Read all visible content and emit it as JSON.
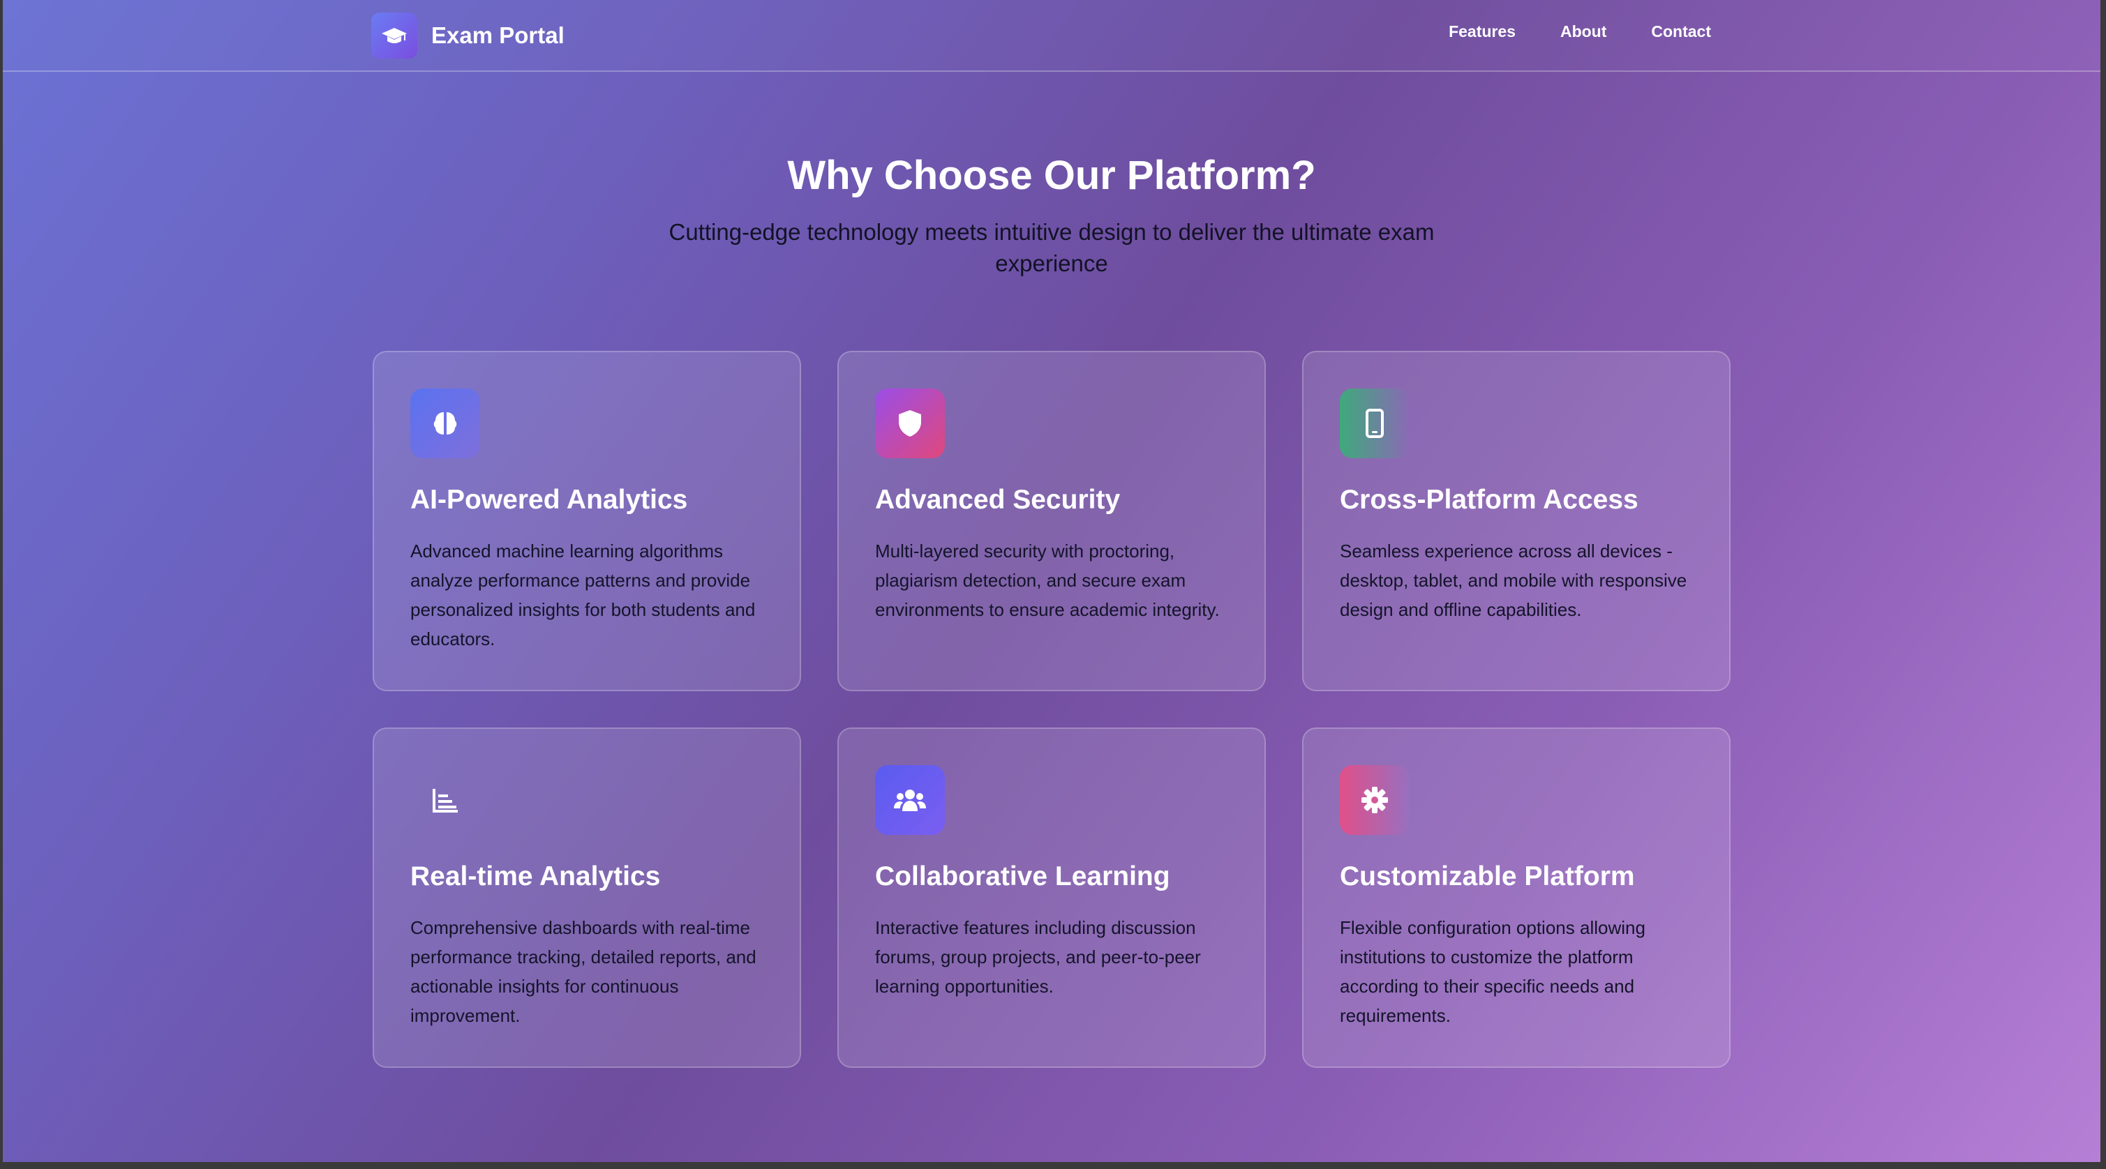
{
  "brand": {
    "name": "Exam Portal",
    "icon": "graduation-cap-icon"
  },
  "nav": {
    "links": [
      "Features",
      "About",
      "Contact"
    ]
  },
  "hero": {
    "title": "Why Choose Our Platform?",
    "subtitle": "Cutting-edge technology meets intuitive design to deliver the ultimate exam experience"
  },
  "features": [
    {
      "title": "AI-Powered Analytics",
      "description": "Advanced machine learning algorithms analyze performance patterns and provide personalized insights for both students and educators.",
      "icon": "brain-icon",
      "color_from": "#5a72f0",
      "color_to": "#7f6fdc"
    },
    {
      "title": "Advanced Security",
      "description": "Multi-layered security with proctoring, plagiarism detection, and secure exam environments to ensure academic integrity.",
      "icon": "shield-icon",
      "color_from": "#9a4ee8",
      "color_to": "#e0487c"
    },
    {
      "title": "Cross-Platform Access",
      "description": "Seamless experience across all devices - desktop, tablet, and mobile with responsive design and offline capabilities.",
      "icon": "mobile-icon",
      "color_from": "#3eaa7c",
      "color_to": "#8a68c0"
    },
    {
      "title": "Real-time Analytics",
      "description": "Comprehensive dashboards with real-time performance tracking, detailed reports, and actionable insights for continuous improvement.",
      "icon": "bar-chart-icon",
      "color_from": "#8a6cc0",
      "color_to": "#8a6cc0"
    },
    {
      "title": "Collaborative Learning",
      "description": "Interactive features including discussion forums, group projects, and peer-to-peer learning opportunities.",
      "icon": "users-icon",
      "color_from": "#5a5cf0",
      "color_to": "#7a5ef0"
    },
    {
      "title": "Customizable Platform",
      "description": "Flexible configuration options allowing institutions to customize the platform according to their specific needs and requirements.",
      "icon": "gear-icon",
      "color_from": "#e0508a",
      "color_to": "#9f72cc"
    }
  ]
}
